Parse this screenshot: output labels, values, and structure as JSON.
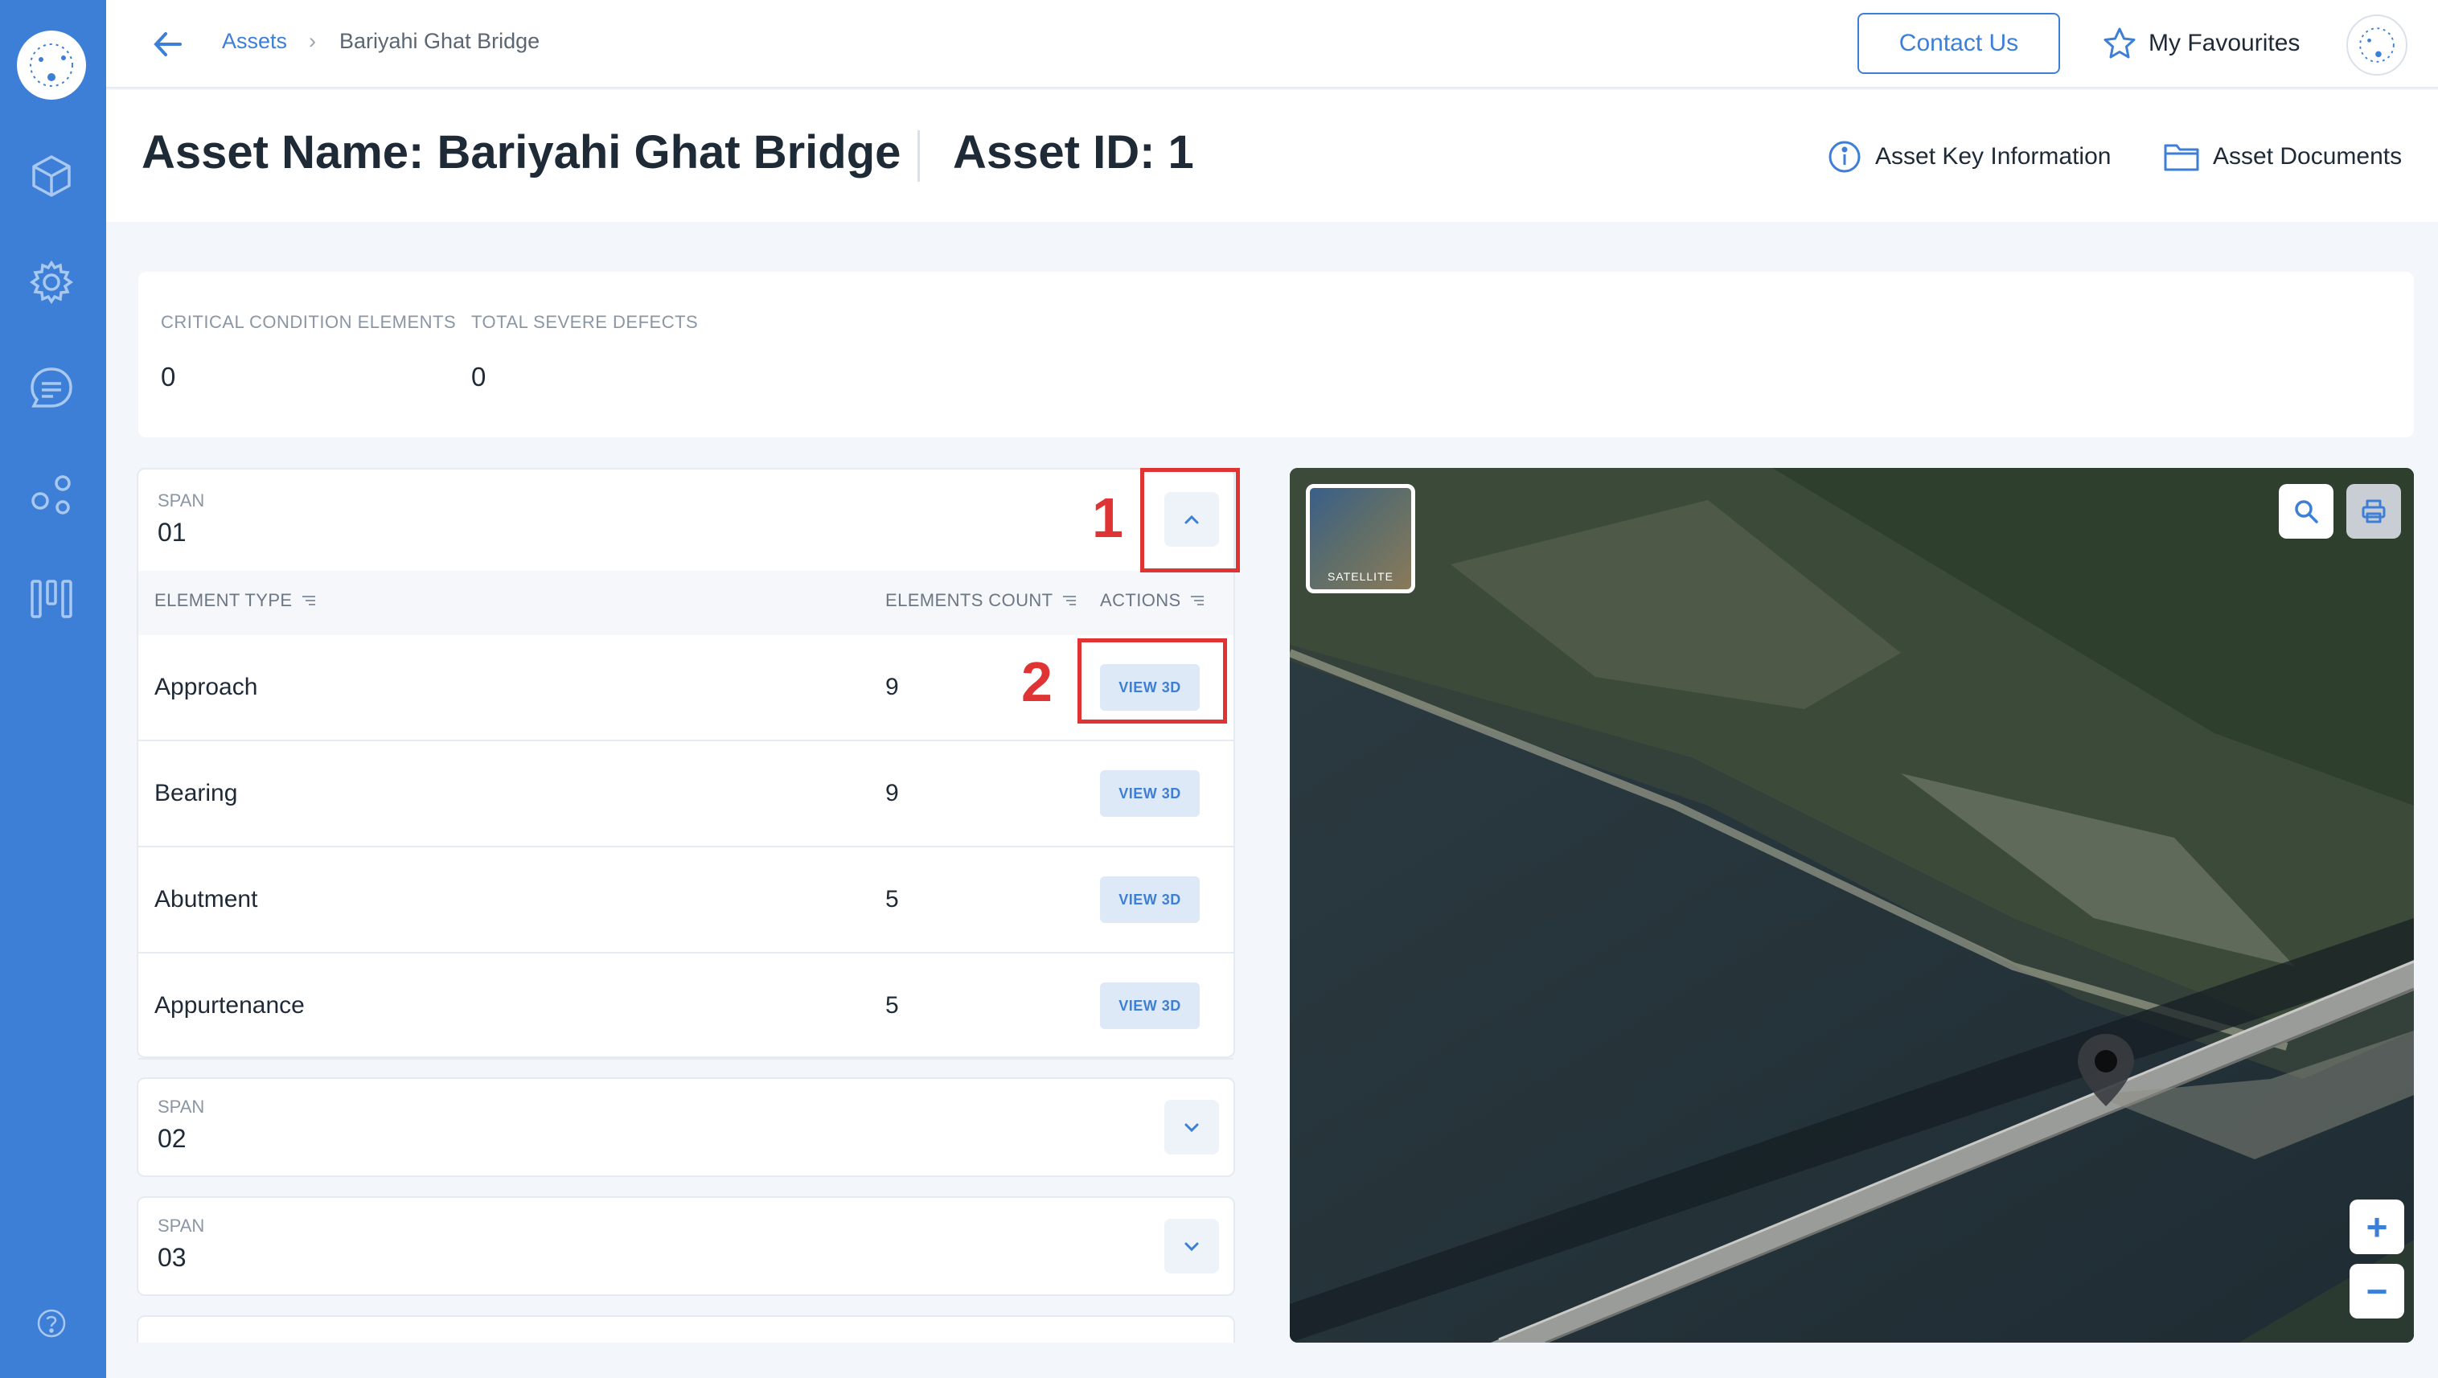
{
  "sidebar": {
    "items": [
      {
        "icon": "cube-icon"
      },
      {
        "icon": "gear-icon"
      },
      {
        "icon": "chat-icon"
      },
      {
        "icon": "network-icon"
      },
      {
        "icon": "dashboard-icon"
      }
    ],
    "help_icon": "help-icon"
  },
  "breadcrumb": {
    "link": "Assets",
    "separator": "›",
    "current": "Bariyahi Ghat Bridge"
  },
  "topbar": {
    "contact_label": "Contact Us",
    "favourites_label": "My Favourites"
  },
  "header": {
    "asset_name": "Asset Name: Bariyahi Ghat Bridge",
    "asset_id": "Asset ID: 1",
    "key_info_label": "Asset Key Information",
    "documents_label": "Asset Documents"
  },
  "stats": [
    {
      "label": "CRITICAL CONDITION ELEMENTS",
      "value": "0"
    },
    {
      "label": "TOTAL SEVERE DEFECTS",
      "value": "0"
    }
  ],
  "spans": [
    {
      "label": "SPAN",
      "value": "01",
      "expanded": true
    },
    {
      "label": "SPAN",
      "value": "02",
      "expanded": false
    },
    {
      "label": "SPAN",
      "value": "03",
      "expanded": false
    }
  ],
  "table": {
    "headers": [
      "ELEMENT TYPE",
      "ELEMENTS COUNT",
      "ACTIONS"
    ],
    "rows": [
      {
        "type": "Approach",
        "count": "9",
        "action": "VIEW 3D"
      },
      {
        "type": "Bearing",
        "count": "9",
        "action": "VIEW 3D"
      },
      {
        "type": "Abutment",
        "count": "5",
        "action": "VIEW 3D"
      },
      {
        "type": "Appurtenance",
        "count": "5",
        "action": "VIEW 3D"
      }
    ]
  },
  "annotations": [
    "1",
    "2"
  ],
  "map": {
    "thumbnail_label": "SATELLITE",
    "zoom_in": "+",
    "zoom_out": "−"
  },
  "colors": {
    "brand": "#3d7fd6",
    "annotation": "#e03434"
  }
}
